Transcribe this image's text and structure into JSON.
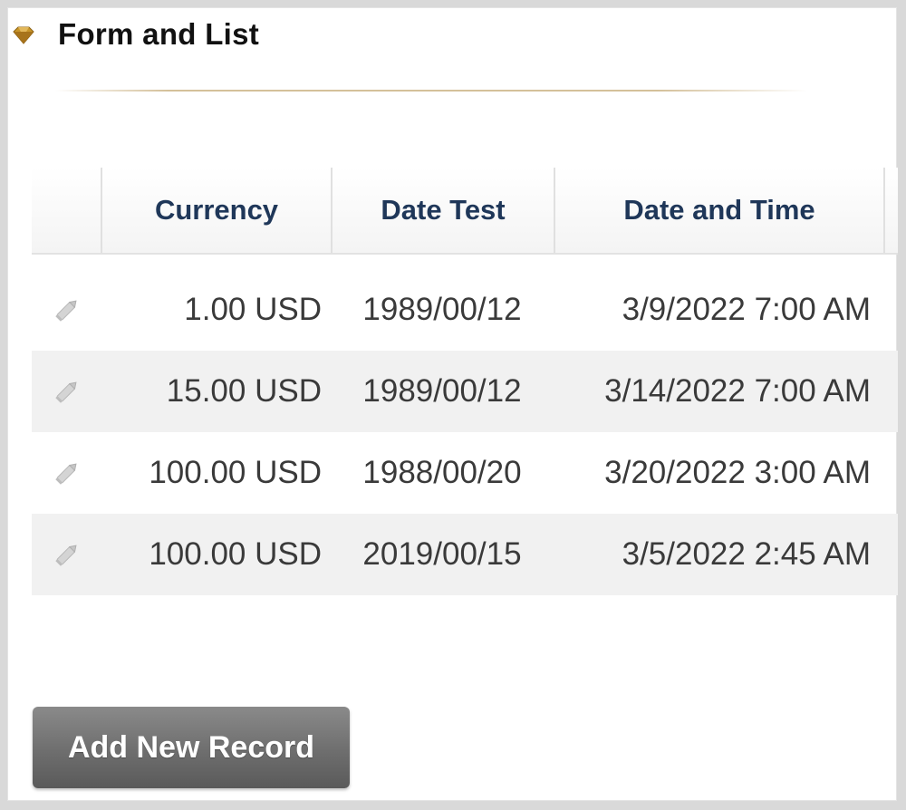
{
  "panel": {
    "title": "Form and List",
    "title_icon": "gold-diamond-bullet-icon"
  },
  "grid": {
    "columns": [
      "",
      "Currency",
      "Date Test",
      "Date and Time"
    ],
    "rows": [
      {
        "currency": "1.00 USD",
        "date_test": "1989/00/12",
        "date_time": "3/9/2022 7:00 AM"
      },
      {
        "currency": "15.00 USD",
        "date_test": "1989/00/12",
        "date_time": "3/14/2022 7:00 AM"
      },
      {
        "currency": "100.00 USD",
        "date_test": "1988/00/20",
        "date_time": "3/20/2022 3:00 AM"
      },
      {
        "currency": "100.00 USD",
        "date_test": "2019/00/15",
        "date_time": "3/5/2022 2:45 AM"
      }
    ],
    "row_icon": "pencil-edit-icon"
  },
  "actions": {
    "add_label": "Add New Record"
  },
  "colors": {
    "header_text": "#1f3759",
    "button_bg": "#6e6e6e",
    "accent_gold": "#c8962a"
  }
}
